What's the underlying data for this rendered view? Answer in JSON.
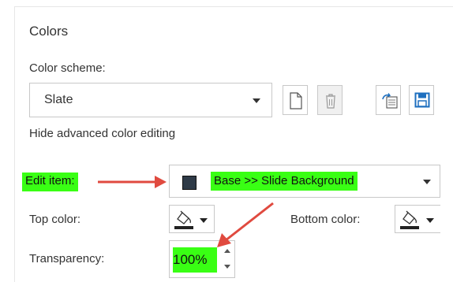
{
  "section": {
    "title": "Colors"
  },
  "color_scheme": {
    "label": "Color scheme:",
    "selected": "Slate",
    "buttons": {
      "new_icon": "new-document-icon",
      "delete_icon": "trash-icon",
      "import_icon": "import-icon",
      "save_icon": "floppy-disk-icon"
    }
  },
  "advanced": {
    "toggle_label": "Hide advanced color editing"
  },
  "edit_item": {
    "label": "Edit item:",
    "selected": "Base >> Slide Background",
    "swatch_color": "#2e3a47"
  },
  "top_color": {
    "label": "Top color:",
    "icon": "paint-bucket-icon"
  },
  "bottom_color": {
    "label": "Bottom color:",
    "icon": "paint-bucket-icon"
  },
  "transparency": {
    "label": "Transparency:",
    "value": "100%"
  },
  "colors": {
    "highlight": "#39ff14",
    "arrow": "#e04a3f",
    "save_icon": "#1e6fbf"
  }
}
